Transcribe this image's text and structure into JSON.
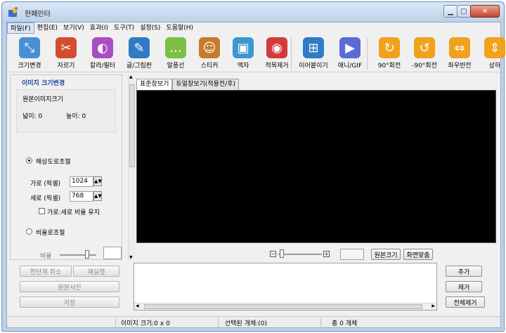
{
  "window": {
    "title": "한페인터"
  },
  "menu": [
    "파일(F)",
    "편집(E)",
    "보기(V)",
    "효과(I)",
    "도구(T)",
    "설정(S)",
    "도움말(H)"
  ],
  "toolbar": [
    {
      "label": "크기변경",
      "icon": "resize-icon",
      "color": "#4a8fd6"
    },
    {
      "label": "자르기",
      "icon": "crop-icon",
      "color": "#d44c2e"
    },
    {
      "label": "칼라/필터",
      "icon": "color-filter-icon",
      "color": "#a94fc1"
    },
    {
      "label": "글/그림판",
      "icon": "text-drawing-icon",
      "color": "#2f7cc4"
    },
    {
      "label": "말풍선",
      "icon": "speech-bubble-icon",
      "color": "#7cc043"
    },
    {
      "label": "스티커",
      "icon": "sticker-icon",
      "color": "#c67b2b"
    },
    {
      "label": "액자",
      "icon": "frame-icon",
      "color": "#3c97cf"
    },
    {
      "label": "적목제거",
      "icon": "red-eye-icon",
      "color": "#d33a3a"
    },
    {
      "label": "이어붙이기",
      "icon": "merge-icon",
      "color": "#2f7cc4"
    },
    {
      "label": "애니/GIF",
      "icon": "gif-icon",
      "color": "#5b6bd6"
    },
    {
      "label": "90°회전",
      "icon": "rotate-cw-icon",
      "color": "#f0a21c"
    },
    {
      "label": "-90°회전",
      "icon": "rotate-ccw-icon",
      "color": "#f0a21c"
    },
    {
      "label": "좌우반전",
      "icon": "flip-horizontal-icon",
      "color": "#f0a21c"
    },
    {
      "label": "상하",
      "icon": "flip-vertical-icon",
      "color": "#f0a21c"
    }
  ],
  "panel": {
    "title": "이미지 크기변경",
    "original_label": "원본이미지크기",
    "width_label": "넓이: 0",
    "height_label": "높이: 0",
    "resolution_label": "해상도로조절",
    "w_label": "가로 (픽셀)",
    "w_value": "1024",
    "h_label": "세로 (픽셀)",
    "h_value": "768",
    "keep_ratio_label": "가로:세로 비율 유지",
    "ratio_option_label": "비율로조절",
    "ratio_label": "비율"
  },
  "actions": {
    "undo": "한단계 취소",
    "redo": "재실행",
    "original": "원본사진",
    "save": "저장"
  },
  "tabs": [
    "표준창보기",
    "듀얼창보기(적용전/후)"
  ],
  "zoom": {
    "original_size": "원본크기",
    "fit_screen": "화면맞춤"
  },
  "list_buttons": {
    "add": "추가",
    "remove": "제거",
    "remove_all": "전체제거"
  },
  "status": {
    "image_size": "이미지 크기:0 x 0",
    "selected": "선택된 개체:(0)",
    "total": "총 0 개체"
  }
}
